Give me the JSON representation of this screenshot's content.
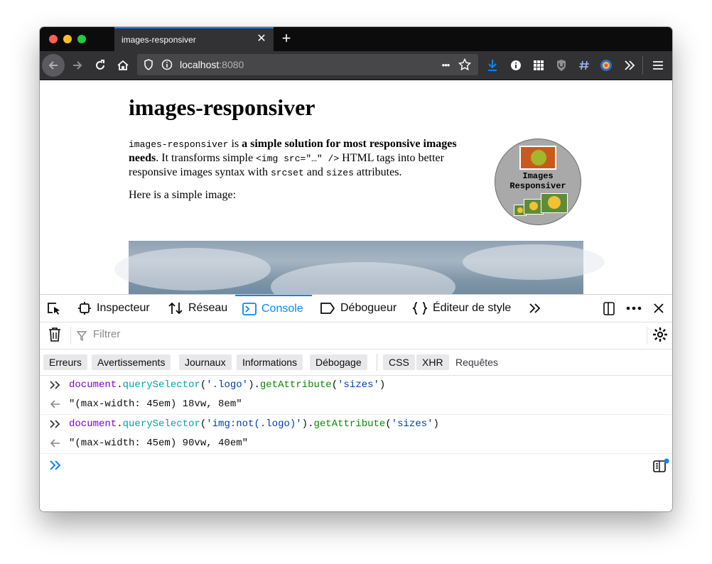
{
  "browser": {
    "tab_title": "images-responsiver",
    "tab_close": "✕",
    "new_tab": "+",
    "url_host": "localhost",
    "url_port": ":8080",
    "url_more": "•••"
  },
  "page": {
    "heading": "images-responsiver",
    "intro_code": "images-responsiver",
    "intro_is": " is ",
    "intro_bold": "a simple solution for most responsive images needs",
    "intro_mid": ". It transforms simple ",
    "intro_img_code": "<img src=\"…\" />",
    "intro_mid2": " HTML tags into better responsive images syntax with ",
    "intro_srcset": "srcset",
    "intro_and": " and ",
    "intro_sizes": "sizes",
    "intro_end": " attributes.",
    "simple_image": "Here is a simple image:",
    "logo_line1": "Images",
    "logo_line2": "Responsiver"
  },
  "devtools": {
    "tabs": {
      "inspector": "Inspecteur",
      "network": "Réseau",
      "console": "Console",
      "debugger": "Débogueur",
      "style_editor": "Éditeur de style"
    },
    "filter_placeholder": "Filtrer",
    "chips": {
      "errors": "Erreurs",
      "warnings": "Avertissements",
      "logs": "Journaux",
      "info": "Informations",
      "debug": "Débogage",
      "css": "CSS",
      "xhr": "XHR",
      "requests": "Requêtes"
    },
    "console": {
      "cmd1_obj": "document",
      "cmd1_fn": "querySelector",
      "cmd1_arg": "'.logo'",
      "cmd1_meth": "getAttribute",
      "cmd1_arg2": "'sizes'",
      "res1": "\"(max-width: 45em) 18vw, 8em\"",
      "cmd2_obj": "document",
      "cmd2_fn": "querySelector",
      "cmd2_arg": "'img:not(.logo)'",
      "cmd2_meth": "getAttribute",
      "cmd2_arg2": "'sizes'",
      "res2": "\"(max-width: 45em) 90vw, 40em\""
    }
  },
  "colors": {
    "accent": "#0a84ff",
    "chrome_dark": "#0c0c0d",
    "toolbar": "#323234"
  }
}
